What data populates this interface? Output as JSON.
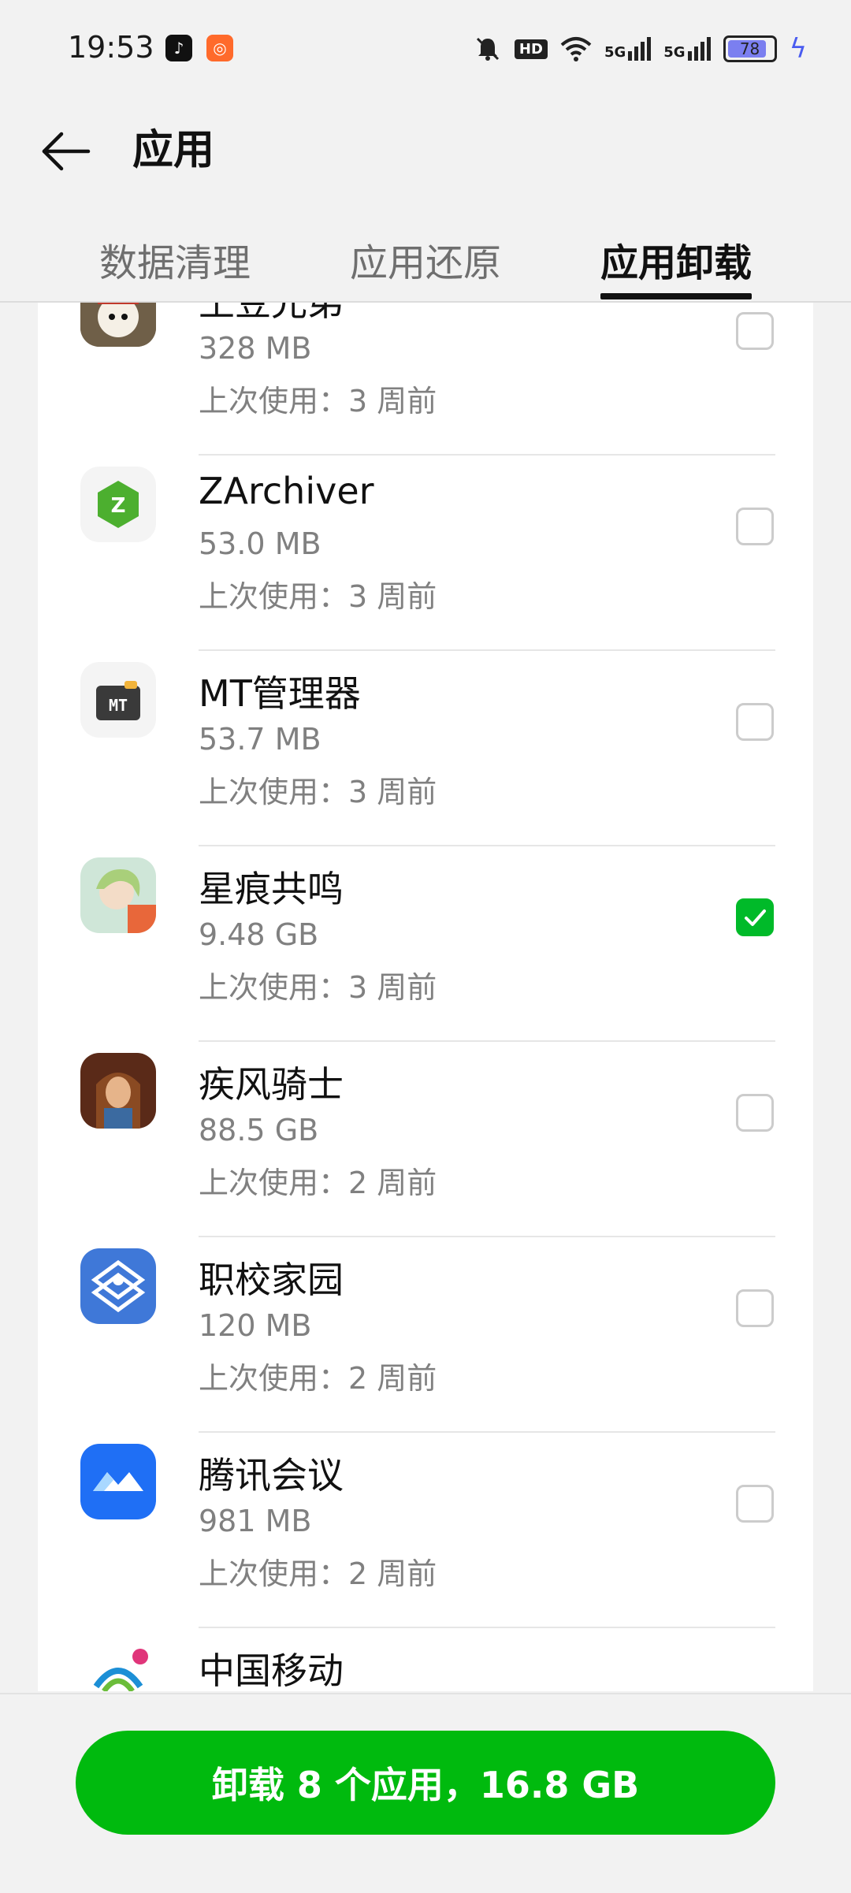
{
  "status_bar": {
    "time": "19:53",
    "battery": "78",
    "icons": [
      "tiktok-icon",
      "xiaohongshu-icon",
      "mute-icon",
      "hd-icon",
      "wifi-icon",
      "signal-5g-icon",
      "signal-5g-icon",
      "battery-icon",
      "charging-icon"
    ],
    "signal_label": "5G",
    "hd_label": "HD"
  },
  "header": {
    "title": "应用"
  },
  "tabs": [
    {
      "label": "数据清理",
      "active": false
    },
    {
      "label": "应用还原",
      "active": false
    },
    {
      "label": "应用卸载",
      "active": true
    }
  ],
  "apps": [
    {
      "name": "土豆兄弟",
      "size": "328 MB",
      "last_used": "上次使用：3 周前",
      "checked": false,
      "icon": "brotato-icon"
    },
    {
      "name": "ZArchiver",
      "size": "53.0 MB",
      "last_used": "上次使用：3 周前",
      "checked": false,
      "icon": "zarchiver-icon"
    },
    {
      "name": "MT管理器",
      "size": "53.7 MB",
      "last_used": "上次使用：3 周前",
      "checked": false,
      "icon": "mt-manager-icon"
    },
    {
      "name": "星痕共鸣",
      "size": "9.48 GB",
      "last_used": "上次使用：3 周前",
      "checked": true,
      "icon": "star-resonance-icon"
    },
    {
      "name": "疾风骑士",
      "size": "88.5 GB",
      "last_used": "上次使用：2 周前",
      "checked": false,
      "icon": "gale-knight-icon"
    },
    {
      "name": "职校家园",
      "size": "120 MB",
      "last_used": "上次使用：2 周前",
      "checked": false,
      "icon": "vocational-home-icon"
    },
    {
      "name": "腾讯会议",
      "size": "981 MB",
      "last_used": "上次使用：2 周前",
      "checked": false,
      "icon": "tencent-meeting-icon"
    },
    {
      "name": "中国移动",
      "size": "",
      "last_used": "",
      "checked": false,
      "icon": "china-mobile-icon"
    }
  ],
  "action": {
    "uninstall_label": "卸载 8 个应用，16.8 GB"
  },
  "colors": {
    "accent_green": "#00ba0e",
    "checkbox_green": "#00ba29"
  }
}
